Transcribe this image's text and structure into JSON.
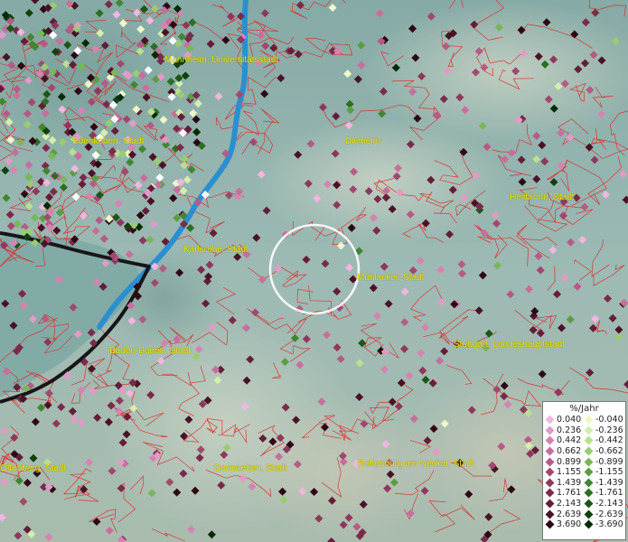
{
  "labels": [
    {
      "text": "Mannheim, Universitätsstadt"
    },
    {
      "text": "Edenkoben, Stadt"
    },
    {
      "text": "Dielheim"
    },
    {
      "text": "Heilbronn, Stadt"
    },
    {
      "text": "Karlsruhe, Stadt"
    },
    {
      "text": "Mühlacker, Stadt"
    },
    {
      "text": "Baden-Baden, Stadt"
    },
    {
      "text": "Stuttgart, Landeshauptstadt"
    },
    {
      "text": "Offenburg, Stadt"
    },
    {
      "text": "Dornstetten, Stadt"
    },
    {
      "text": "Rottenburg am Neckar, Stadt"
    }
  ],
  "legend": {
    "title": "%/Jahr",
    "positive": [
      {
        "value": "0.040",
        "color": "#f2b6e0"
      },
      {
        "value": "0.236",
        "color": "#e29ac6"
      },
      {
        "value": "0.442",
        "color": "#d683b2"
      },
      {
        "value": "0.662",
        "color": "#c86e9c"
      },
      {
        "value": "0.899",
        "color": "#b65a86"
      },
      {
        "value": "1.155",
        "color": "#a24870"
      },
      {
        "value": "1.439",
        "color": "#8e385c"
      },
      {
        "value": "1.761",
        "color": "#7a2a4a"
      },
      {
        "value": "2.143",
        "color": "#641e38"
      },
      {
        "value": "2.639",
        "color": "#4a1226"
      },
      {
        "value": "3.690",
        "color": "#2e0614"
      }
    ],
    "negative": [
      {
        "value": "-0.040",
        "color": "#eef8c8"
      },
      {
        "value": "-0.236",
        "color": "#d4eeac"
      },
      {
        "value": "-0.442",
        "color": "#b8e08e"
      },
      {
        "value": "-0.662",
        "color": "#98cc72"
      },
      {
        "value": "-0.899",
        "color": "#78b65a"
      },
      {
        "value": "-1.155",
        "color": "#5a9e44"
      },
      {
        "value": "-1.439",
        "color": "#408630"
      },
      {
        "value": "-1.761",
        "color": "#2c6e22"
      },
      {
        "value": "-2.143",
        "color": "#1c5616"
      },
      {
        "value": "-2.639",
        "color": "#10400e"
      },
      {
        "value": "-3.690",
        "color": "#062a06"
      }
    ]
  },
  "colors": {
    "boundary": "#dd2a2a",
    "river": "#2a8fd0",
    "border": "#161616",
    "label": "#e8e600",
    "selection": "#ffffff"
  }
}
